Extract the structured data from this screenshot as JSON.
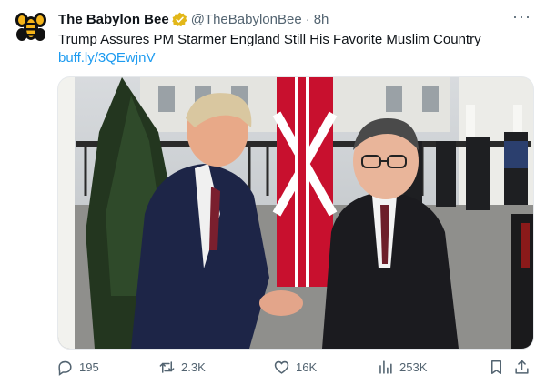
{
  "tweet": {
    "author_name": "The Babylon Bee",
    "handle": "@TheBabylonBee",
    "separator": "·",
    "time": "8h",
    "text": "Trump Assures PM Starmer England Still His Favorite Muslim Country",
    "link": "buff.ly/3QEwjnV",
    "more_label": "···",
    "verified": true
  },
  "actions": {
    "replies": "195",
    "reposts": "2.3K",
    "likes": "16K",
    "views": "253K"
  },
  "icons": {
    "avatar": "babylon-bee-logo",
    "badge": "verified-gold-badge",
    "reply": "speech-bubble",
    "repost": "repost-arrows",
    "like": "heart",
    "views": "bar-chart",
    "bookmark": "bookmark",
    "share": "share-arrow"
  },
  "colors": {
    "link": "#1d9bf0",
    "badge": "#e2b719",
    "muted": "#536471",
    "text": "#0f1419"
  }
}
